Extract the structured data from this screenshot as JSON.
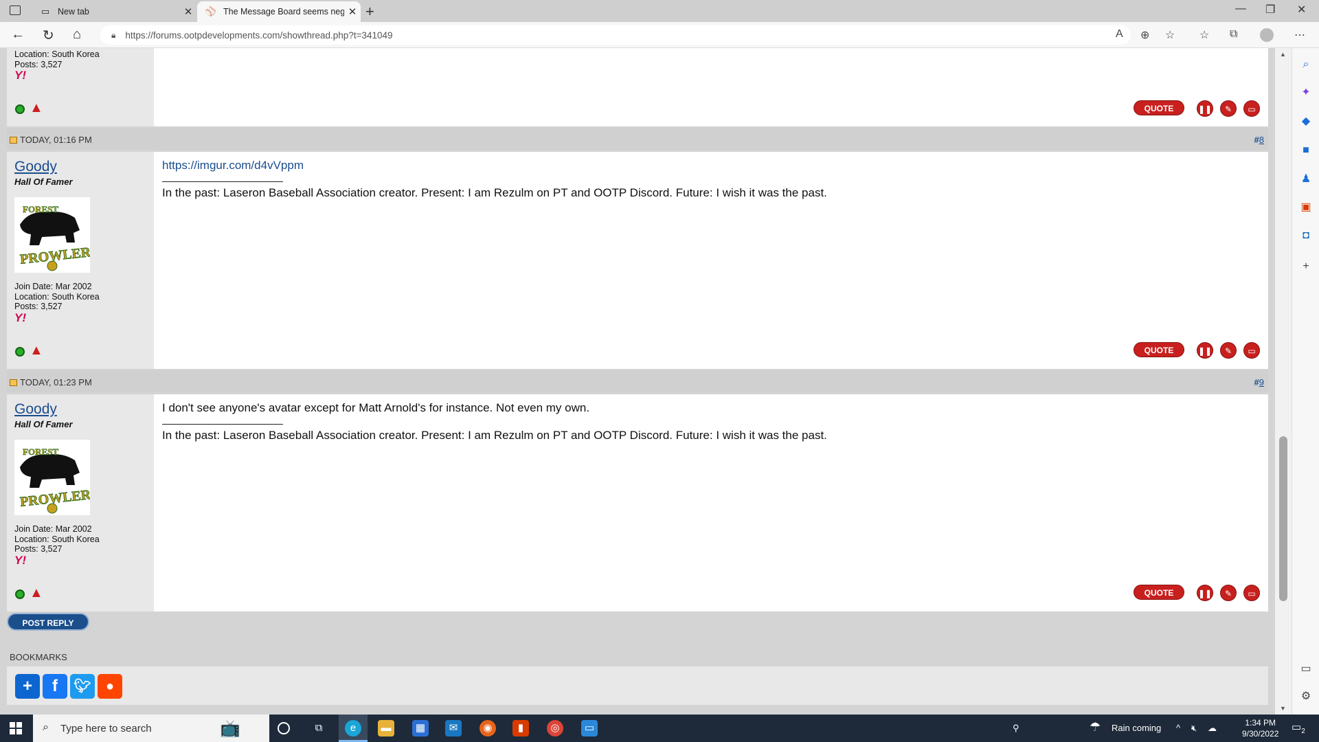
{
  "browser": {
    "tabs": [
      {
        "title": "New tab"
      },
      {
        "title": "The Message Board seems negle"
      }
    ],
    "url": "https://forums.ootpdevelopments.com/showthread.php?t=341049"
  },
  "prev_post": {
    "location": "Location: South Korea",
    "posts": "Posts: 3,527"
  },
  "posts": [
    {
      "date": "TODAY, 01:16 PM",
      "number_prefix": "#",
      "number": "8",
      "username": "Goody",
      "user_title": "Hall Of Famer",
      "avatar_text_top": "FOREST",
      "avatar_text_main": "PROWLERS",
      "join_date": "Join Date: Mar 2002",
      "location": "Location: South Korea",
      "posts": "Posts: 3,527",
      "message_link": "https://imgur.com/d4vVppm",
      "signature": "In the past: Laseron Baseball Association creator. Present: I am Rezulm on PT and OOTP Discord. Future: I wish it was the past."
    },
    {
      "date": "TODAY, 01:23 PM",
      "number_prefix": "#",
      "number": "9",
      "username": "Goody",
      "user_title": "Hall Of Famer",
      "avatar_text_top": "FOREST",
      "avatar_text_main": "PROWLERS",
      "join_date": "Join Date: Mar 2002",
      "location": "Location: South Korea",
      "posts": "Posts: 3,527",
      "message_text": "I don't see anyone's avatar except for Matt Arnold's for instance. Not even my own.",
      "signature": "In the past: Laseron Baseball Association creator. Present: I am Rezulm on PT and OOTP Discord. Future: I wish it was the past."
    }
  ],
  "buttons": {
    "quote": "QUOTE",
    "post_reply": "POST REPLY"
  },
  "bookmarks": {
    "label": "BOOKMARKS"
  },
  "taskbar": {
    "search_placeholder": "Type here to search",
    "weather": "Rain coming",
    "time": "1:34 PM",
    "date": "9/30/2022",
    "notification_count": "2"
  },
  "colors": {
    "accent_red": "#c8201e",
    "link_blue": "#1a4d8f",
    "post_reply_blue": "#1b4f8c"
  }
}
